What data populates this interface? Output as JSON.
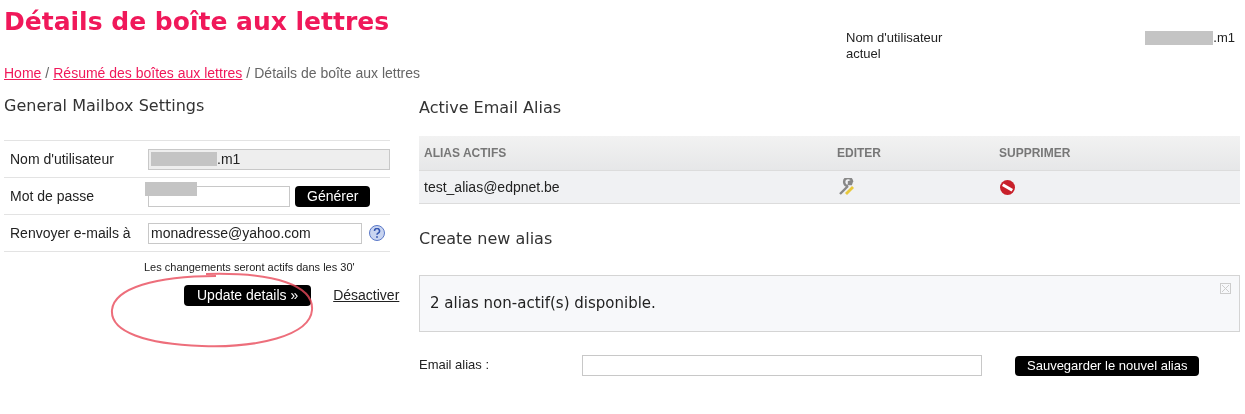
{
  "page_title": "Détails de boîte aux lettres",
  "current_user": {
    "label": "Nom d'utilisateur actuel",
    "value": ".m1"
  },
  "breadcrumb": [
    {
      "text": "Home",
      "kind": "link"
    },
    {
      "text": "/",
      "kind": "separator"
    },
    {
      "text": "Résumé des boîtes aux lettres",
      "kind": "link"
    },
    {
      "text": "/",
      "kind": "separator"
    },
    {
      "text": "Détails de boîte aux lettres",
      "kind": "current"
    }
  ],
  "general_settings": {
    "heading": "General Mailbox Settings",
    "fields": [
      {
        "label": "Nom d'utilisateur",
        "value": ".m1",
        "disabled": true,
        "kind": "text"
      },
      {
        "label": "Mot de passe",
        "disabled": false,
        "kind": "password",
        "button": "Générer"
      },
      {
        "label": "Renvoyer e-mails à",
        "value": "monadresse@yahoo.com",
        "disabled": false,
        "kind": "help"
      }
    ],
    "note": "Les changements seront actifs dans les 30'",
    "update_button": "Update details »",
    "deactivate_link": "Désactiver"
  },
  "active_alias": {
    "heading": "Active Email Alias",
    "columns": [
      "ALIAS ACTIFS",
      "EDITER",
      "SUPPRIMER"
    ],
    "rows": [
      {
        "alias": "test_alias@edpnet.be"
      }
    ]
  },
  "create_alias": {
    "heading": "Create new alias",
    "message": "2 alias non-actif(s) disponible.",
    "field_label": "Email alias :",
    "save_button": "Sauvegarder le nouvel alias"
  }
}
